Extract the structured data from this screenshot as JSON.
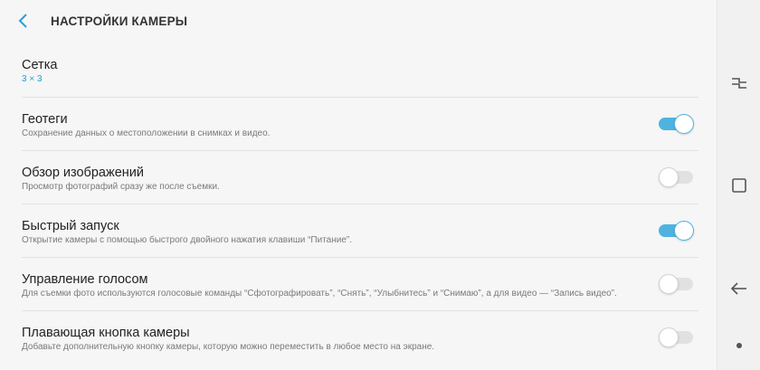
{
  "header": {
    "title": "НАСТРОЙКИ КАМЕРЫ"
  },
  "settings": [
    {
      "title": "Сетка",
      "subtitle": "3 × 3",
      "toggle": null
    },
    {
      "title": "Геотеги",
      "subtitle": "Сохранение данных о местоположении в снимках и видео.",
      "toggle": true
    },
    {
      "title": "Обзор изображений",
      "subtitle": "Просмотр фотографий сразу же после съемки.",
      "toggle": false
    },
    {
      "title": "Быстрый запуск",
      "subtitle": "Открытие камеры с помощью быстрого двойного нажатия клавиши “Питание”.",
      "toggle": true
    },
    {
      "title": "Управление голосом",
      "subtitle": "Для съемки фото используются голосовые команды “Сфотографировать”, “Снять”, “Улыбнитесь” и “Снимаю”, а для видео — “Запись видео”.",
      "toggle": false
    },
    {
      "title": "Плавающая кнопка камеры",
      "subtitle": "Добавьте дополнительную кнопку камеры, которую можно переместить в любое место на экране.",
      "toggle": false
    }
  ],
  "icons": {
    "back": "back-arrow-icon",
    "recent": "recent-apps-icon",
    "home": "home-icon",
    "nav_back": "nav-back-icon",
    "dot": "dot-icon"
  },
  "colors": {
    "accent": "#4fb3e0",
    "subtitle_accent": "#1e9fd7"
  }
}
